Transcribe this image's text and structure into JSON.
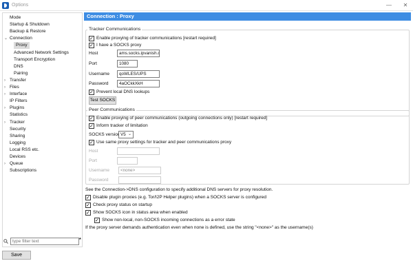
{
  "window": {
    "title": "Options",
    "minimize": "—",
    "close": "✕"
  },
  "sidebar": {
    "items": [
      {
        "label": "Mode",
        "level": 0,
        "arrow": ""
      },
      {
        "label": "Startup & Shutdown",
        "level": 0,
        "arrow": ""
      },
      {
        "label": "Backup & Restore",
        "level": 0,
        "arrow": ""
      },
      {
        "label": "Connection",
        "level": 0,
        "arrow": "⌄"
      },
      {
        "label": "Proxy",
        "level": 1,
        "arrow": "",
        "selected": true
      },
      {
        "label": "Advanced Network Settings",
        "level": 1,
        "arrow": ""
      },
      {
        "label": "Transport Encryption",
        "level": 1,
        "arrow": ""
      },
      {
        "label": "DNS",
        "level": 1,
        "arrow": ""
      },
      {
        "label": "Pairing",
        "level": 1,
        "arrow": ""
      },
      {
        "label": "Transfer",
        "level": 0,
        "arrow": "›"
      },
      {
        "label": "Files",
        "level": 0,
        "arrow": "›"
      },
      {
        "label": "Interface",
        "level": 0,
        "arrow": "›"
      },
      {
        "label": "IP Filters",
        "level": 0,
        "arrow": ""
      },
      {
        "label": "Plugins",
        "level": 0,
        "arrow": "›"
      },
      {
        "label": "Statistics",
        "level": 0,
        "arrow": ""
      },
      {
        "label": "Tracker",
        "level": 0,
        "arrow": "›"
      },
      {
        "label": "Security",
        "level": 0,
        "arrow": ""
      },
      {
        "label": "Sharing",
        "level": 0,
        "arrow": ""
      },
      {
        "label": "Logging",
        "level": 0,
        "arrow": ""
      },
      {
        "label": "Local RSS etc.",
        "level": 0,
        "arrow": ""
      },
      {
        "label": "Devices",
        "level": 0,
        "arrow": ""
      },
      {
        "label": "Queue",
        "level": 0,
        "arrow": "›"
      },
      {
        "label": "Subscriptions",
        "level": 0,
        "arrow": ""
      }
    ],
    "filter_placeholder": "type filter text",
    "filter_star": "*"
  },
  "footer": {
    "save_label": "Save"
  },
  "content": {
    "header": "Connection : Proxy",
    "tracker": {
      "title": "Tracker Communications",
      "enable_label": "Enable proxying of tracker communications [restart required]",
      "enable_checked": true,
      "socks_label": "I have a SOCKS proxy",
      "socks_checked": true,
      "host_label": "Host",
      "host_value": "ams.socks.ipvanish.co",
      "port_label": "Port",
      "port_value": "1080",
      "username_label": "Username",
      "username_value": "qoWLES/UPS",
      "password_label": "Password",
      "password_value": "4aOCkkXkH",
      "prevent_dns_label": "Prevent local DNS lookups",
      "prevent_dns_checked": true,
      "test_button": "Test SOCKS"
    },
    "peer": {
      "title": "Peer Communications",
      "enable_label": "Enable proxying of peer communications (outgoing connections only) [restart required]",
      "enable_checked": true,
      "inform_label": "Inform tracker of limitation",
      "inform_checked": true,
      "socks_version_label": "SOCKS version",
      "socks_version_value": "V5",
      "same_settings_label": "Use same proxy settings for tracker and peer communications proxy",
      "same_settings_checked": true,
      "host_label": "Host",
      "host_value": "",
      "port_label": "Port",
      "port_value": "",
      "username_label": "Username",
      "username_value": "<none>",
      "password_label": "Password",
      "password_value": ""
    },
    "dns_note": "See the Connection->DNS configuration to specify additional DNS servers for proxy resolution.",
    "disable_plugin_label": "Disable plugin proxies (e.g. Tor/I2P Helper plugins) when a SOCKS server is configured",
    "disable_plugin_checked": true,
    "check_status_label": "Check proxy status on startup",
    "check_status_checked": true,
    "show_icon_label": "Show SOCKS icon in status area when enabled",
    "show_icon_checked": true,
    "show_nonlocal_label": "Show non-local, non-SOCKS incoming connections as a error state",
    "show_nonlocal_checked": true,
    "auth_note": "If the proxy server demands authentication even when none is defined, use the string \"<none>\" as the username(s)"
  },
  "colors": {
    "header_bg": "#3e8de3",
    "selected_bg": "#dcdcdc"
  }
}
